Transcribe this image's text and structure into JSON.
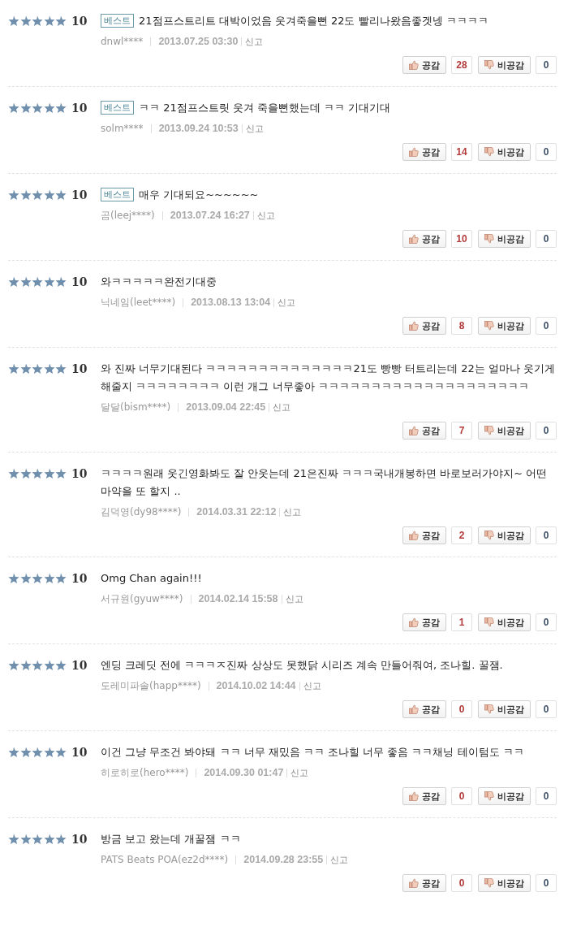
{
  "reviews": [
    {
      "stars": 5,
      "score": "10",
      "badge": "베스트",
      "text": "21점프스트리트 대박이었음 웃겨죽을뻔 22도 빨리나왔음좋겟넹 ㅋㅋㅋㅋ",
      "author": "dnwl****",
      "date": "2013.07.25 03:30",
      "report": "신고",
      "like_label": "공감",
      "likes": "28",
      "dislike_label": "비공감",
      "dislikes": "0"
    },
    {
      "stars": 5,
      "score": "10",
      "badge": "베스트",
      "text": "ㅋㅋ 21점프스트릿 웃겨 죽을뻔했는데 ㅋㅋ 기대기대",
      "author": "solm****",
      "date": "2013.09.24 10:53",
      "report": "신고",
      "like_label": "공감",
      "likes": "14",
      "dislike_label": "비공감",
      "dislikes": "0"
    },
    {
      "stars": 5,
      "score": "10",
      "badge": "베스트",
      "text": "매우 기대되요~~~~~~",
      "author": "곰(leej****)",
      "date": "2013.07.24 16:27",
      "report": "신고",
      "like_label": "공감",
      "likes": "10",
      "dislike_label": "비공감",
      "dislikes": "0"
    },
    {
      "stars": 5,
      "score": "10",
      "text": "와ㅋㅋㅋㅋㅋ완전기대중",
      "author": "닉네임(leet****)",
      "date": "2013.08.13 13:04",
      "report": "신고",
      "like_label": "공감",
      "likes": "8",
      "dislike_label": "비공감",
      "dislikes": "0"
    },
    {
      "stars": 5,
      "score": "10",
      "text": "와 진짜 너무기대된다 ㅋㅋㅋㅋㅋㅋㅋㅋㅋㅋㅋㅋㅋㅋ21도 빵빵 터트리는데 22는 얼마나 웃기게 해줄지 ㅋㅋㅋㅋㅋㅋㅋㅋ 이런 개그 너무좋아 ㅋㅋㅋㅋㅋㅋㅋㅋㅋㅋㅋㅋㅋㅋㅋㅋㅋㅋㅋㅋ",
      "author": "달달(bism****)",
      "date": "2013.09.04 22:45",
      "report": "신고",
      "like_label": "공감",
      "likes": "7",
      "dislike_label": "비공감",
      "dislikes": "0"
    },
    {
      "stars": 5,
      "score": "10",
      "text": "ㅋㅋㅋㅋ원래 웃긴영화봐도 잘 안웃는데 21은진짜 ㅋㅋㅋ국내개봉하면 바로보러가야지~ 어떤 마약을 또 할지 ..",
      "author": "김덕영(dy98****)",
      "date": "2014.03.31 22:12",
      "report": "신고",
      "like_label": "공감",
      "likes": "2",
      "dislike_label": "비공감",
      "dislikes": "0"
    },
    {
      "stars": 5,
      "score": "10",
      "text": "Omg Chan again!!!",
      "author": "서규원(gyuw****)",
      "date": "2014.02.14 15:58",
      "report": "신고",
      "like_label": "공감",
      "likes": "1",
      "dislike_label": "비공감",
      "dislikes": "0"
    },
    {
      "stars": 5,
      "score": "10",
      "text": "엔딩 크레딧 전에 ㅋㅋㅋㅈ진짜 상상도 못했닭 시리즈 계속 만들어줘여, 조나힐. 꿀잼.",
      "author": "도레미파솔(happ****)",
      "date": "2014.10.02 14:44",
      "report": "신고",
      "like_label": "공감",
      "likes": "0",
      "dislike_label": "비공감",
      "dislikes": "0"
    },
    {
      "stars": 5,
      "score": "10",
      "text": "이건 그냥 무조건 봐야돼 ㅋㅋ 너무 재밌음 ㅋㅋ 조나힐 너무 좋음 ㅋㅋ채닝 테이텀도 ㅋㅋ",
      "author": "히로히로(hero****)",
      "date": "2014.09.30 01:47",
      "report": "신고",
      "like_label": "공감",
      "likes": "0",
      "dislike_label": "비공감",
      "dislikes": "0"
    },
    {
      "stars": 5,
      "score": "10",
      "text": "방금 보고 왔는데 개꿀잼 ㅋㅋ",
      "author": "PATS Beats POA(ez2d****)",
      "date": "2014.09.28 23:55",
      "report": "신고",
      "like_label": "공감",
      "likes": "0",
      "dislike_label": "비공감",
      "dislikes": "0"
    }
  ]
}
